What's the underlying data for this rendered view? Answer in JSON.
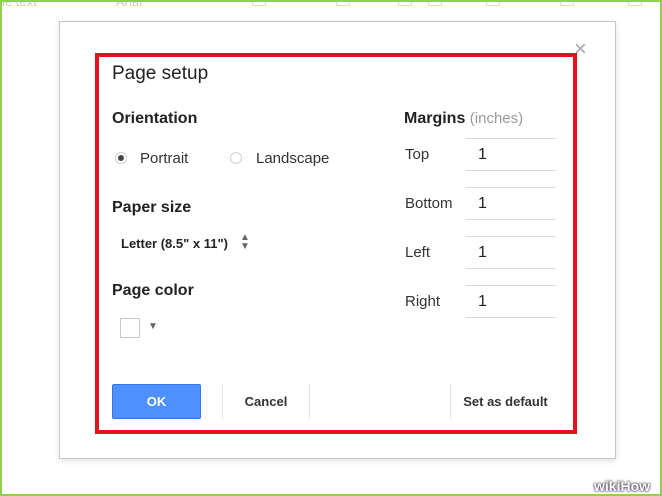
{
  "background_toolbar": {
    "item1": "ie text",
    "item2": "Arial"
  },
  "dialog": {
    "title": "Page setup",
    "orientation": {
      "heading": "Orientation",
      "options": [
        "Portrait",
        "Landscape"
      ],
      "selected": "Portrait"
    },
    "paper_size": {
      "heading": "Paper size",
      "value": "Letter (8.5\" x 11\")"
    },
    "page_color": {
      "heading": "Page color",
      "value": "#ffffff"
    },
    "margins": {
      "heading": "Margins",
      "unit": "(inches)",
      "fields": [
        {
          "label": "Top",
          "value": "1"
        },
        {
          "label": "Bottom",
          "value": "1"
        },
        {
          "label": "Left",
          "value": "1"
        },
        {
          "label": "Right",
          "value": "1"
        }
      ]
    },
    "buttons": {
      "ok": "OK",
      "cancel": "Cancel",
      "set_default": "Set as default"
    },
    "close_glyph": "×"
  },
  "annotation": {
    "highlight_color": "#e8101e",
    "frame_color": "#8fd14a"
  },
  "watermark": "wikiHow"
}
